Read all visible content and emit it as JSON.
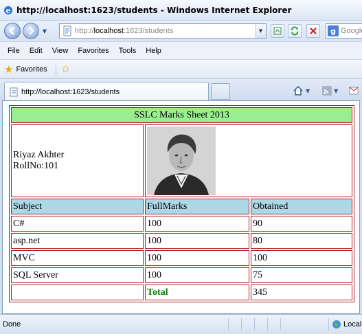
{
  "window": {
    "title": "http://localhost:1623/students - Windows Internet Explorer"
  },
  "address_bar": {
    "prefix": "http://",
    "host": "localhost",
    "path": ":1623/students"
  },
  "search": {
    "placeholder": "Google"
  },
  "menu": {
    "items": [
      "File",
      "Edit",
      "View",
      "Favorites",
      "Tools",
      "Help"
    ]
  },
  "favorites_bar": {
    "label": "Favorites"
  },
  "tab": {
    "label": "http://localhost:1623/students"
  },
  "page": {
    "heading": "SSLC Marks Sheet 2013",
    "student_name": "Riyaz Akhter",
    "roll": "RollNo:101",
    "columns": [
      "Subject",
      "FullMarks",
      "Obtained"
    ],
    "rows": [
      [
        "C#",
        "100",
        "90"
      ],
      [
        "asp.net",
        "100",
        "80"
      ],
      [
        "MVC",
        "100",
        "100"
      ],
      [
        "SQL Server",
        "100",
        "75"
      ]
    ],
    "total_label": "Total",
    "total_value": "345"
  },
  "status": {
    "text": "Done",
    "zone": "Local"
  },
  "icons": {
    "back": "back-arrow-icon",
    "forward": "forward-arrow-icon",
    "refresh": "refresh-icon",
    "stop": "stop-icon",
    "favorites": "star-icon",
    "home": "home-icon",
    "feeds": "rss-icon"
  }
}
